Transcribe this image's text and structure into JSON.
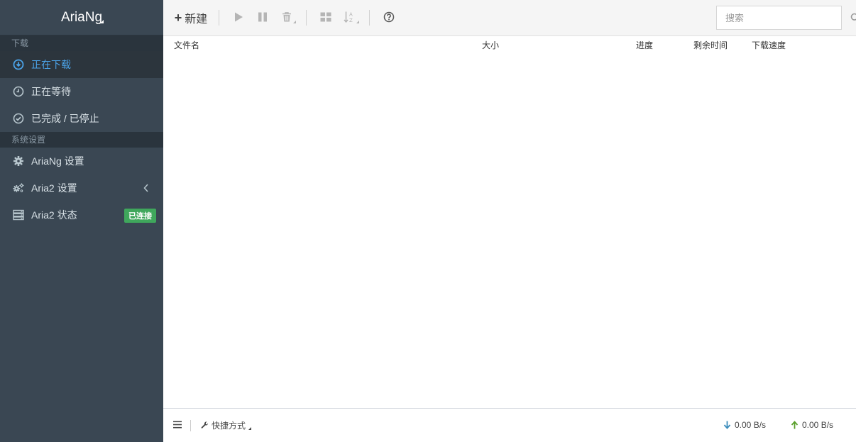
{
  "app": {
    "title": "AriaNg"
  },
  "sidebar": {
    "sections": [
      {
        "title": "下载"
      },
      {
        "title": "系统设置"
      }
    ],
    "download_items": [
      {
        "label": "正在下载",
        "icon": "download-circle-icon"
      },
      {
        "label": "正在等待",
        "icon": "clock-icon"
      },
      {
        "label": "已完成 / 已停止",
        "icon": "check-circle-icon"
      }
    ],
    "settings_items": [
      {
        "label": "AriaNg 设置",
        "icon": "gear-icon"
      },
      {
        "label": "Aria2 设置",
        "icon": "gears-icon"
      },
      {
        "label": "Aria2 状态",
        "icon": "server-icon",
        "badge": "已连接"
      }
    ]
  },
  "toolbar": {
    "new_label": "新建",
    "search_placeholder": "搜索"
  },
  "table": {
    "columns": [
      "文件名",
      "大小",
      "进度",
      "剩余时间",
      "下载速度"
    ]
  },
  "footer": {
    "shortcut_label": "快捷方式",
    "download_speed": "0.00 B/s",
    "upload_speed": "0.00 B/s"
  },
  "colors": {
    "sidebar_bg": "#3a4753",
    "active_text": "#4ba3e8",
    "badge_bg": "#3fa75c",
    "download_arrow": "#3c8dbc",
    "upload_arrow": "#5aa02c"
  }
}
